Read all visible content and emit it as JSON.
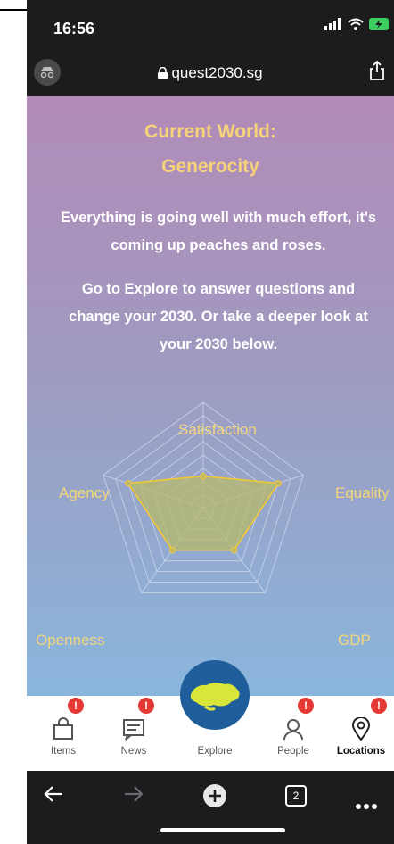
{
  "status": {
    "time": "16:56",
    "signal_icon": "signal-bars-icon",
    "wifi_icon": "wifi-icon",
    "battery_icon": "battery-charging-icon"
  },
  "browser": {
    "url": "quest2030.sg",
    "lock_icon": "lock-icon",
    "incognito_icon": "incognito-icon",
    "share_icon": "share-icon"
  },
  "world": {
    "title_line1": "Current World:",
    "title_line2": "Generocity",
    "desc_line1": "Everything is going well with much effort, it's",
    "desc_line2": "coming up peaches and roses.",
    "info_line1": "Go to Explore to answer questions and",
    "info_line2": "change your 2030. Or take a deeper look at",
    "info_line3": "your 2030 below."
  },
  "chart_data": {
    "type": "radar",
    "axes": [
      "Satisfaction",
      "Equality",
      "GDP",
      "Openness",
      "Agency"
    ],
    "axis_labels": {
      "satisfaction": "Satisfaction",
      "equality": "Equality",
      "gdp": "GDP",
      "openness": "Openness",
      "agency": "Agency"
    },
    "values": {
      "Satisfaction": 0.3,
      "Equality": 0.75,
      "GDP": 0.5,
      "Openness": 0.5,
      "Agency": 0.75
    },
    "colors": {
      "fill": "#b7b96a",
      "stroke": "#f0c838",
      "grid": "#c9d6e8"
    }
  },
  "tabs": [
    {
      "label": "Items",
      "icon": "shopping-bag-icon",
      "badge": "!"
    },
    {
      "label": "News",
      "icon": "news-icon",
      "badge": "!"
    },
    {
      "label": "Explore",
      "icon": "singapore-map-icon"
    },
    {
      "label": "People",
      "icon": "person-icon",
      "badge": "!"
    },
    {
      "label": "Locations",
      "icon": "location-pin-icon",
      "badge": "!"
    }
  ],
  "browser_bar": {
    "back_icon": "back-arrow-icon",
    "forward_icon": "forward-arrow-icon",
    "new_tab_icon": "plus-icon",
    "tab_count": "2",
    "more_icon": "more-icon"
  }
}
